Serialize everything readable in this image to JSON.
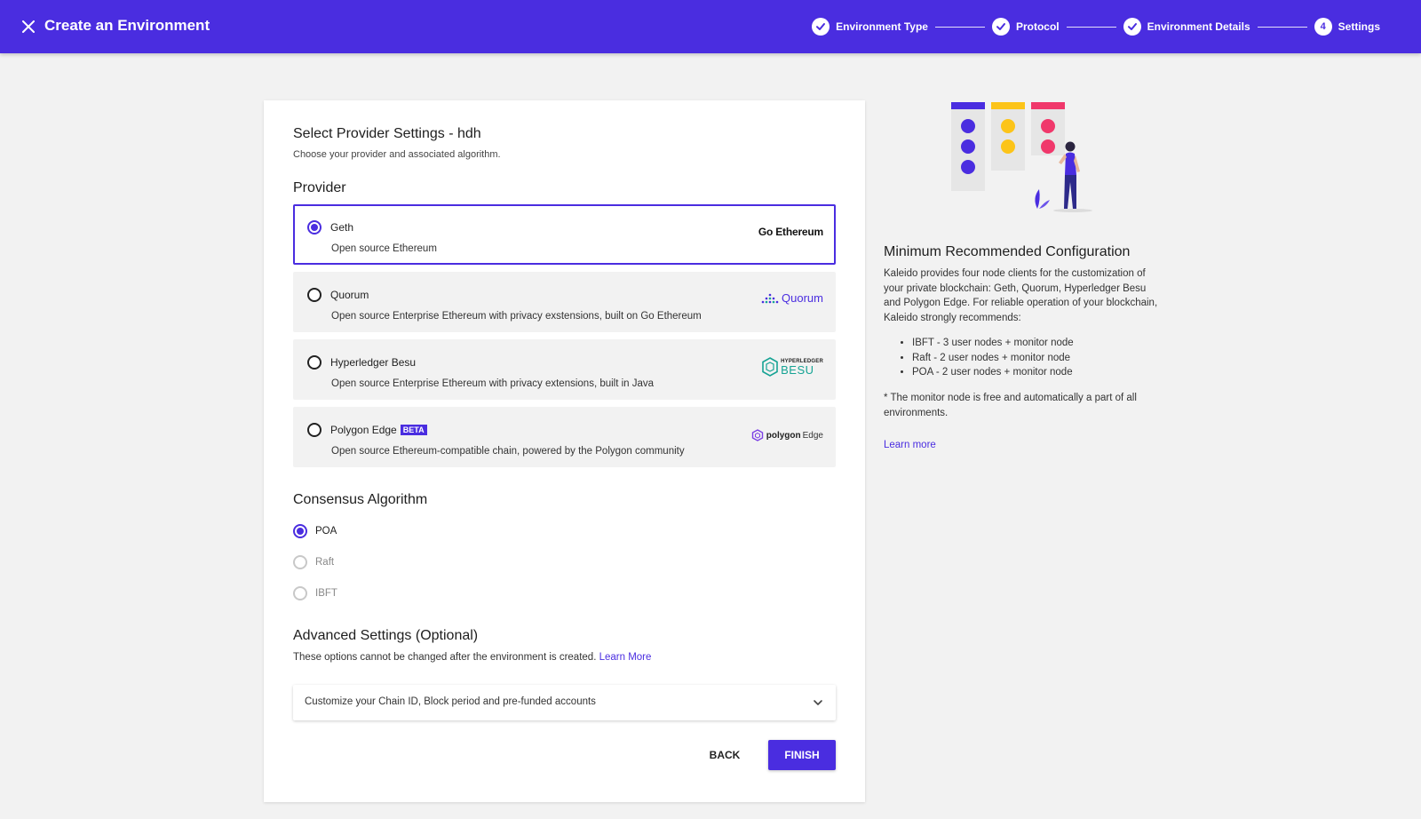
{
  "header": {
    "title": "Create an Environment",
    "steps": [
      {
        "label": "Environment Type",
        "state": "done"
      },
      {
        "label": "Protocol",
        "state": "done"
      },
      {
        "label": "Environment Details",
        "state": "done"
      },
      {
        "label": "Settings",
        "number": "4",
        "state": "current"
      }
    ]
  },
  "form": {
    "title": "Select Provider Settings - hdh",
    "subtitle": "Choose your provider and associated algorithm.",
    "provider_heading": "Provider",
    "providers": [
      {
        "name": "Geth",
        "description": "Open source Ethereum",
        "logo_text": "Go Ethereum",
        "selected": true
      },
      {
        "name": "Quorum",
        "description": "Open source Enterprise Ethereum with privacy exstensions, built on Go Ethereum",
        "logo_text": "Quorum",
        "selected": false
      },
      {
        "name": "Hyperledger Besu",
        "description": "Open source Enterprise Ethereum with privacy extensions, built in Java",
        "logo_top": "HYPERLEDGER",
        "logo_text": "BESU",
        "selected": false
      },
      {
        "name": "Polygon Edge",
        "badge": "BETA",
        "description": "Open source Ethereum-compatible chain, powered by the Polygon community",
        "logo_bold": "polygon",
        "logo_text": "Edge",
        "selected": false
      }
    ],
    "consensus_heading": "Consensus Algorithm",
    "consensus": [
      {
        "label": "POA",
        "selected": true,
        "enabled": true
      },
      {
        "label": "Raft",
        "selected": false,
        "enabled": false
      },
      {
        "label": "IBFT",
        "selected": false,
        "enabled": false
      }
    ],
    "advanced_heading": "Advanced Settings (Optional)",
    "advanced_text": "These options cannot be changed after the environment is created.",
    "advanced_link": "Learn More",
    "accordion_label": "Customize your Chain ID, Block period and pre-funded accounts",
    "back_label": "BACK",
    "finish_label": "FINISH"
  },
  "side_panel": {
    "title": "Minimum Recommended Configuration",
    "body": "Kaleido provides four node clients for the customization of your private blockchain: Geth, Quorum, Hyperledger Besu and Polygon Edge. For reliable operation of your blockchain, Kaleido strongly recommends:",
    "items": [
      "IBFT - 3 user nodes + monitor node",
      "Raft - 2 user nodes + monitor node",
      "POA - 2 user nodes + monitor node"
    ],
    "note": "* The monitor node is free and automatically a part of all environments.",
    "link": "Learn more"
  },
  "colors": {
    "brand": "#4a2de0",
    "yellow": "#fcc419",
    "pink": "#f0386b",
    "teal": "#16a394"
  }
}
